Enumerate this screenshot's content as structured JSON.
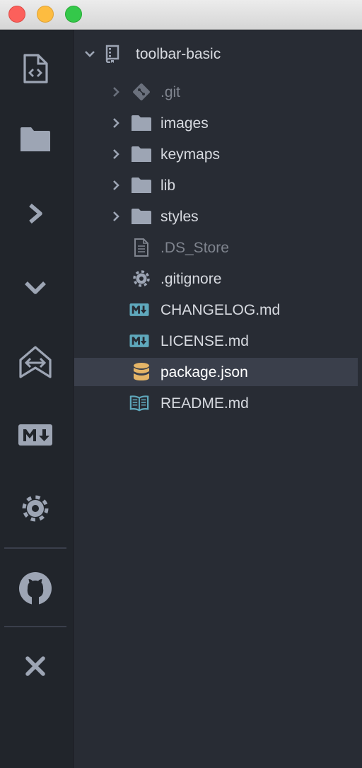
{
  "window": {
    "controls": [
      "close",
      "minimize",
      "maximize"
    ]
  },
  "toolbar": {
    "buttons": [
      {
        "icon": "code-file-icon"
      },
      {
        "icon": "folder-icon"
      },
      {
        "icon": "chevron-right-icon"
      },
      {
        "icon": "chevron-down-icon"
      },
      {
        "icon": "split-arrows-icon"
      },
      {
        "icon": "markdown-icon"
      },
      {
        "icon": "gear-icon"
      },
      {
        "icon": "github-icon"
      },
      {
        "icon": "close-x-icon"
      }
    ]
  },
  "tree": {
    "root": {
      "label": "toolbar-basic",
      "expanded": true,
      "icon": "repo-icon"
    },
    "items": [
      {
        "label": ".git",
        "type": "folder",
        "icon": "git-icon",
        "dim": true
      },
      {
        "label": "images",
        "type": "folder",
        "icon": "folder-icon"
      },
      {
        "label": "keymaps",
        "type": "folder",
        "icon": "folder-icon"
      },
      {
        "label": "lib",
        "type": "folder",
        "icon": "folder-icon"
      },
      {
        "label": "styles",
        "type": "folder",
        "icon": "folder-icon"
      },
      {
        "label": ".DS_Store",
        "type": "file",
        "icon": "file-text-icon",
        "dim": true
      },
      {
        "label": ".gitignore",
        "type": "file",
        "icon": "gear-icon"
      },
      {
        "label": "CHANGELOG.md",
        "type": "file",
        "icon": "markdown-icon"
      },
      {
        "label": "LICENSE.md",
        "type": "file",
        "icon": "markdown-icon"
      },
      {
        "label": "package.json",
        "type": "file",
        "icon": "database-icon",
        "selected": true
      },
      {
        "label": "README.md",
        "type": "file",
        "icon": "book-icon"
      }
    ]
  },
  "colors": {
    "toolbar_bg": "#21252b",
    "tree_bg": "#282c34",
    "selection_bg": "#3a3f4b",
    "icon_gray": "#9da5b4",
    "markdown_teal": "#5fa8bc",
    "database_orange": "#e5b567"
  }
}
